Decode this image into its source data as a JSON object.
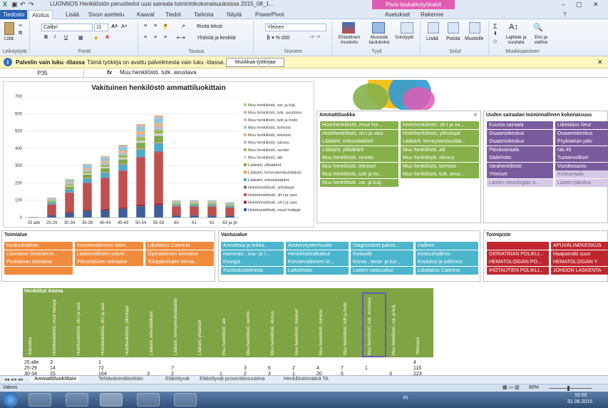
{
  "window": {
    "title": "LUONNOS Henkilöstön perustiedot uusi sairaala toimintokokonaisuuksissa 2015_08_1...",
    "context_tab": "Pivot-taulukkotyökalut"
  },
  "tabs": [
    "Tiedosto",
    "Aloitus",
    "Lisää",
    "Sivun asettelu",
    "Kaavat",
    "Tiedot",
    "Tarkista",
    "Näytä",
    "PowerPivot",
    "Asetukset",
    "Rakenne"
  ],
  "ribbon": {
    "paste": "Liitä",
    "clipboard": "Leikepöytä",
    "font": "Calibri",
    "size": "11",
    "font_group": "Fontti",
    "wrap": "Rivitä teksti",
    "merge": "Yhdistä ja keskitä",
    "align_group": "Tasaus",
    "number_format": "Yleinen",
    "number_group": "Numero",
    "cond": "Ehdollinen muotoilu",
    "table": "Muotoile taulukoksi",
    "styles": "Solutyylit",
    "style_group": "Tyyli",
    "insert": "Lisää",
    "delete": "Poista",
    "format": "Muotoile",
    "cells_group": "Solut",
    "sort": "Lajittele ja suodata",
    "find": "Etsi ja valitse",
    "edit_group": "Muokkaaminen"
  },
  "infobar": {
    "title": "Palvelin vain luku -tilassa",
    "text": "Tämä työkirja on avattu palvelimesta vain luku -tilassa.",
    "button": "Muokkaa työkirjaa"
  },
  "formula": {
    "cell": "P35",
    "fx": "fx",
    "value": "Muu henkilöstö, tutk. avustava"
  },
  "chart_data": {
    "type": "bar",
    "title": "Vakituinen henkilöstö ammattiluokittain",
    "categories": [
      "25 alle",
      "25-29",
      "30-34",
      "35-39",
      "40-44",
      "45-49",
      "50-54",
      "55-59",
      "60",
      "61",
      "62",
      "63 ja yli"
    ],
    "totals": [
      4,
      116,
      223,
      310,
      355,
      420,
      480,
      540,
      590,
      100,
      100,
      100,
      90
    ],
    "values": [
      4,
      116,
      223,
      310,
      355,
      420,
      540,
      590,
      100,
      100,
      100,
      90
    ],
    "ylim": [
      0,
      700
    ],
    "yticks": [
      0,
      100,
      200,
      300,
      400,
      500,
      600,
      700
    ],
    "legend": [
      "Muu henkilöstö, var. ja kulj.",
      "Muu henkilöstö, tutk. avustava",
      "Muu henkilöstö, tutk ja hoito",
      "Muu henkilöstö, toimisto",
      "Muu henkilöstö, tekniset",
      "Muu henkilöstö, siivous",
      "Muu henkilöstö, ravinto",
      "Muu henkilöstö, atk",
      "Lääkärit, ylilääkärit",
      "Lääkärit, terveyskeskuslääkäri",
      "Lääkärit, erikoislääkärit",
      "Hoitohenkilöstö, ylihoitajat",
      "Hoitohenkilöstö, sh:t ja vast.",
      "Hoitohenkilöstö, oh:t ja vast.",
      "Hoitohenkilöstö, muut hoitajat"
    ],
    "legend_colors": [
      "#b5cf7a",
      "#e8a0a0",
      "#c7b8d8",
      "#8fc7d8",
      "#f2b079",
      "#a6bfe0",
      "#9bbb59",
      "#d9d9d9",
      "#7fa84a",
      "#f79646",
      "#4bacc6",
      "#8064a2",
      "#c0504d",
      "#9b2e2e",
      "#3d5f9c"
    ]
  },
  "slicers": {
    "ammattiluokka": {
      "title": "Ammattiluokka",
      "items": [
        "Hoitohenkilöstö, muut hoi...",
        "Hoitohenkilöstö, oh:t ja va...",
        "Hoitohenkilöstö, sh:t ja vast.",
        "Hoitohenkilöstö, ylihoitajat",
        "Lääkärit, erikoislääkärit",
        "Lääkärit, terveyskeskuslää...",
        "Lääkärit, ylilääkärit",
        "Muu henkilöstö, atk",
        "Muu henkilöstö, ravinto",
        "Muu henkilöstö, siivous",
        "Muu henkilöstö, tekniset",
        "Muu henkilöstö, toimisto",
        "Muu henkilöstö, tutk ja ho...",
        "Muu henkilöstö, tutk. avus...",
        "Muu henkilöstö, var. ja kulj."
      ]
    },
    "uusi": {
      "title": "Uuden sairaalan toiminnallinen kokonaisuus",
      "items": [
        "Kuuma sairaala",
        "Liikelaitos Seut",
        "Osaamiskeskus",
        "Osaamiskeskus",
        "Osaamiskeskus",
        "Psykiatrian päiv",
        "Päiväsairaala",
        "rak.45",
        "Sädehoito",
        "Tuotannolliset",
        "Varahenkilöstö",
        "Vuodeosasto",
        "Yhteiset",
        "Kotisairaala",
        "Lasten neurologian p...",
        "Lasten päiväsa"
      ]
    },
    "toimialue": {
      "title": "Toimialue",
      "items": [
        "Keskushallinto",
        "Konservatiivinen toimi...",
        "Liikelaitos Caterina",
        "Liikelaitos Seututerve...",
        "Lääkinnällisten palvel...",
        "Operatiivinen toimialue",
        "Psykiatrian toimialue",
        "Päivystyksen toimialue",
        "Tukipalvelujen toimia...",
        ""
      ]
    },
    "vastuualue": {
      "title": "Vastuualue",
      "items": [
        "Anestesia ja leikka...",
        "Avoterveydenhuolto",
        "Diagnostiset palvel...",
        "Hallinto",
        "Hammas-, suu- ja l...",
        "Henkilöstöratkaisut",
        "Ihotaudit",
        "Keskushallinto",
        "Kirurgia",
        "Konservatiivisen to...",
        "Korva-, nenä- ja kur...",
        "Koulutus ja tutkimus",
        "Kuntoutustoiminta",
        "Laitoshoito",
        "Lasten vastuualue",
        "Liikelaitos Caterina"
      ]
    },
    "toimipiste": {
      "title": "Toimipiste",
      "items": [
        "",
        "APUVÄLINEKESKUS",
        "GERIATRIAN POLIKLI...",
        "Haapamäki suun",
        "HEMATOLOGIAN PO...",
        "HEMATOLOGIAN Y",
        "IHOTAUTIEN POLIKLI...",
        "JOHDON LASKENTA"
      ]
    }
  },
  "pivot": {
    "header": "Henkilöst Amma",
    "columns": [
      "Ikäluokka",
      "Hoitohenkilöstö, muut hoitajat",
      "Hoitohenkilöstö, oh:t ja vast.",
      "Hoitohenkilöstö, sh:t ja vast.",
      "Hoitohenkilöstö, ylihoitajat",
      "Lääkärit, erikoislääkärit",
      "Lääkärit, terveyskeskuslääkäri",
      "Lääkärit, ylilääkärit",
      "Muu henkilöstö, atk",
      "Muu henkilöstö, ravinto",
      "Muu henkilöstö, siivous",
      "Muu henkilöstö, tekniset",
      "Muu henkilöstö, toimisto",
      "Muu henkilöstö, tutk ja hoito",
      "Muu henkilöstö, tutk. avustava",
      "Muu henkilöstö, var. ja kulj.",
      "Yhteensä"
    ],
    "rows": [
      [
        "25 alle",
        "3",
        "",
        "1",
        "",
        "",
        "",
        "",
        "",
        "",
        "",
        "",
        "",
        "",
        "",
        "",
        "4"
      ],
      [
        "25-29",
        "14",
        "",
        "72",
        "",
        "",
        "7",
        "",
        "",
        "3",
        "6",
        "2",
        "4",
        "7",
        "1",
        "",
        "116"
      ],
      [
        "30-34",
        "15",
        "",
        "164",
        "",
        "3",
        "2",
        "",
        "1",
        "2",
        "3",
        "1",
        "20",
        "5",
        "",
        "3",
        "223"
      ]
    ]
  },
  "sheet_tabs": [
    "Ammattiluokittain",
    "Tehtävänimikkeittäin",
    "Eläköityvät",
    "Eläköityvät prosenttiosuutena",
    "Henkilöstömäärä TA"
  ],
  "status": {
    "mode": "Valmis",
    "zoom": "80%"
  },
  "taskbar": {
    "lang": "FI",
    "time": "10:50",
    "date": "31.08.2015"
  }
}
